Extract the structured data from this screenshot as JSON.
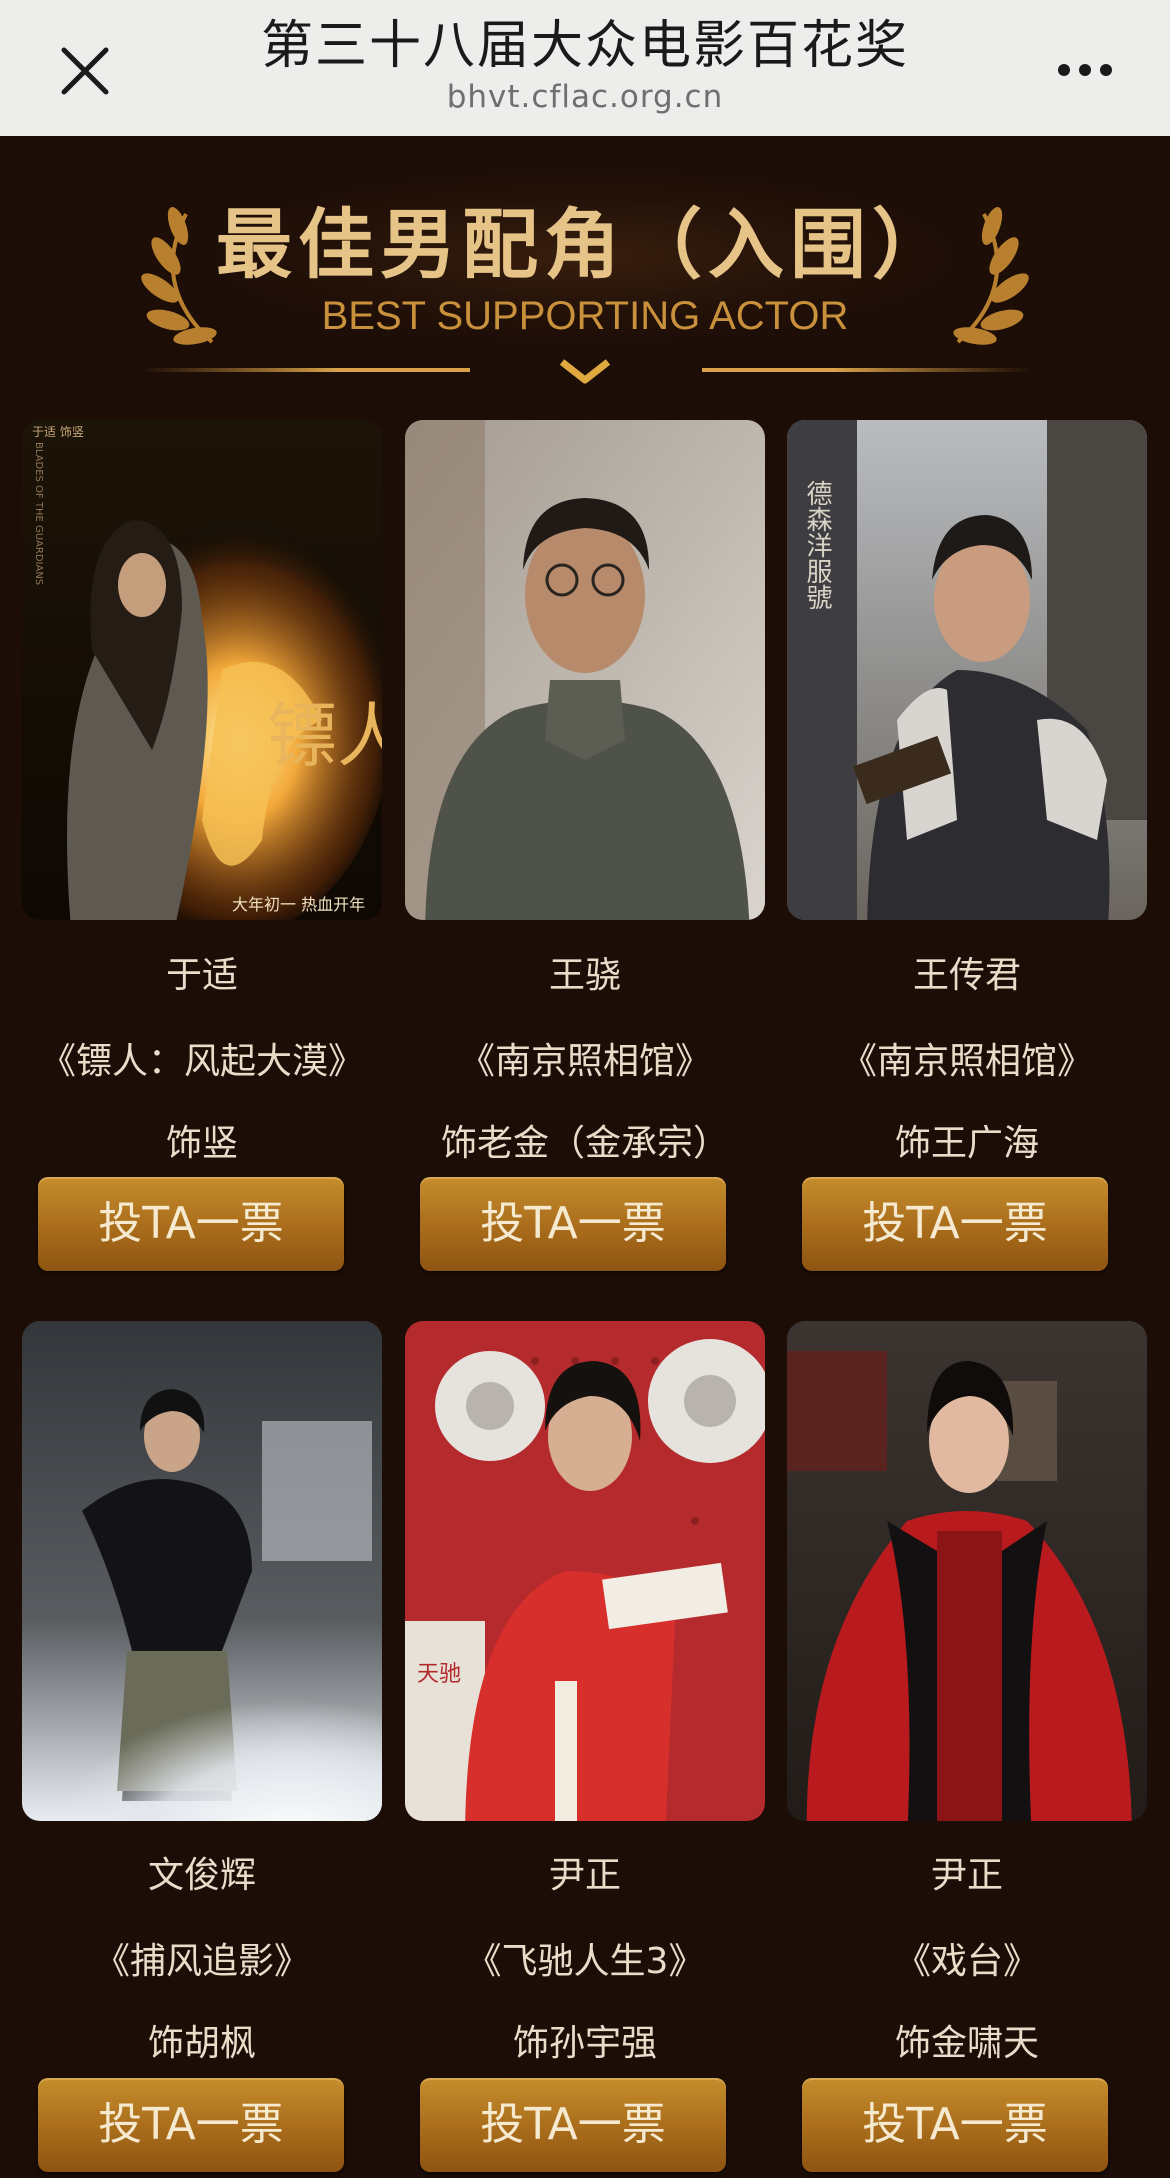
{
  "header": {
    "title": "第三十八届大众电影百花奖",
    "url": "bhvt.cflac.org.cn",
    "close_icon": "close-icon",
    "more_icon": "more-horizontal-icon"
  },
  "banner": {
    "title": "最佳男配角（入围）",
    "subtitle": "BEST SUPPORTING ACTOR"
  },
  "colors": {
    "background": "#1c0d07",
    "gold": "#c9913b",
    "button": "#b07420",
    "text": "#e9ddc9"
  },
  "nominees": [
    {
      "name": "于适",
      "film": "《镖人：风起大漠》",
      "role": "饰竖",
      "vote_label": "投TA一票",
      "poster": {
        "title": "镖人",
        "tagline": "大年初一 热血开年",
        "credit": "于适 饰竖",
        "subtitle": "BLADES OF THE GUARDIANS"
      }
    },
    {
      "name": "王骁",
      "film": "《南京照相馆》",
      "role": "饰老金（金承宗）",
      "vote_label": "投TA一票"
    },
    {
      "name": "王传君",
      "film": "《南京照相馆》",
      "role": "饰王广海",
      "vote_label": "投TA一票",
      "poster": {
        "sign": "德森洋服號"
      }
    },
    {
      "name": "文俊辉",
      "film": "《捕风追影》",
      "role": "饰胡枫",
      "vote_label": "投TA一票"
    },
    {
      "name": "尹正",
      "film": "《飞驰人生3》",
      "role": "饰孙宇强",
      "vote_label": "投TA一票",
      "poster": {
        "text": "天驰"
      }
    },
    {
      "name": "尹正",
      "film": "《戏台》",
      "role": "饰金啸天",
      "vote_label": "投TA一票"
    }
  ]
}
